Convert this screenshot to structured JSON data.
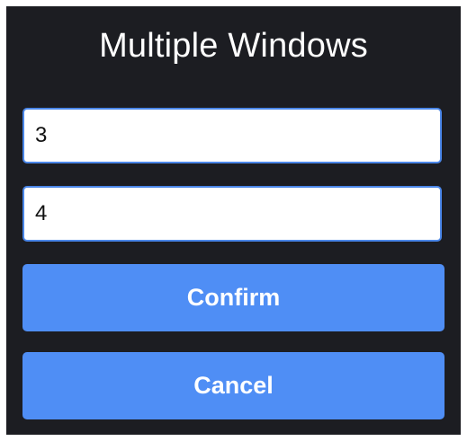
{
  "dialog": {
    "title": "Multiple Windows",
    "fields": [
      {
        "value": "3"
      },
      {
        "value": "4"
      }
    ],
    "buttons": {
      "confirm_label": "Confirm",
      "cancel_label": "Cancel"
    }
  },
  "colors": {
    "background": "#1c1d22",
    "button": "#4f8ef5",
    "field_border": "#4a86e8",
    "text_light": "#ffffff"
  }
}
